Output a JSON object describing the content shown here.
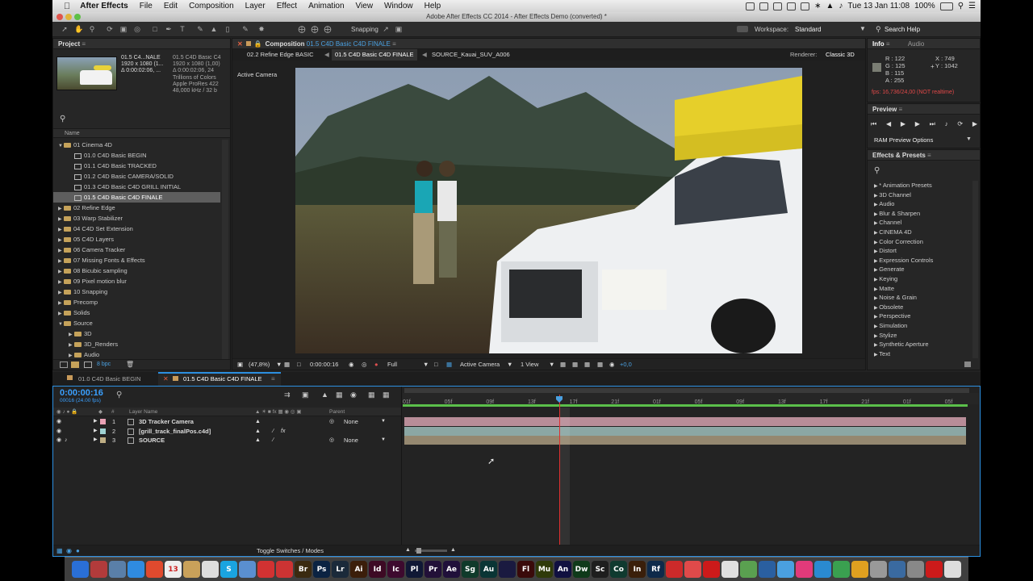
{
  "menubar": {
    "app_name": "After Effects",
    "items": [
      "File",
      "Edit",
      "Composition",
      "Layer",
      "Effect",
      "Animation",
      "View",
      "Window",
      "Help"
    ],
    "clock": "Tue 13 Jan 11:08",
    "battery": "100%"
  },
  "window": {
    "title": "Adobe After Effects CC 2014 - After Effects Demo (converted) *"
  },
  "toolbar": {
    "snapping_label": "Snapping",
    "workspace_label": "Workspace:",
    "workspace_value": "Standard",
    "search_help": "Search Help"
  },
  "project": {
    "tab_label": "Project",
    "thumb_name": "01.5 C4...NALE",
    "info_lines": [
      "01.5 C4D Basic C4",
      "1920 x 1080 (1,00)",
      "Δ 0:00:02:06, 24",
      "Trillions of Colors",
      "Apple ProRes 422",
      "48,000 kHz / 32 b"
    ],
    "info_small": [
      "1920 x 1080 (1...",
      "Δ 0:00:02:06, ..."
    ],
    "col_name": "Name",
    "bpc": "8 bpc",
    "tree": [
      {
        "label": "01 Cinema 4D",
        "level": 0,
        "type": "folder",
        "open": true
      },
      {
        "label": "01.0 C4D Basic BEGIN",
        "level": 1,
        "type": "comp"
      },
      {
        "label": "01.1 C4D Basic TRACKED",
        "level": 1,
        "type": "comp"
      },
      {
        "label": "01.2 C4D Basic CAMERA/SOLID",
        "level": 1,
        "type": "comp"
      },
      {
        "label": "01.3 C4D Basic C4D GRILL INITIAL",
        "level": 1,
        "type": "comp"
      },
      {
        "label": "01.5 C4D Basic C4D FINALE",
        "level": 1,
        "type": "comp",
        "selected": true
      },
      {
        "label": "02 Refine Edge",
        "level": 0,
        "type": "folder"
      },
      {
        "label": "03 Warp Stabilizer",
        "level": 0,
        "type": "folder"
      },
      {
        "label": "04 C4D Set Extension",
        "level": 0,
        "type": "folder"
      },
      {
        "label": "05 C4D Layers",
        "level": 0,
        "type": "folder"
      },
      {
        "label": "06 Camera Tracker",
        "level": 0,
        "type": "folder"
      },
      {
        "label": "07 Missing Fonts & Effects",
        "level": 0,
        "type": "folder"
      },
      {
        "label": "08 Bicubic sampling",
        "level": 0,
        "type": "folder"
      },
      {
        "label": "09 Pixel motion blur",
        "level": 0,
        "type": "folder"
      },
      {
        "label": "10 Snapping",
        "level": 0,
        "type": "folder"
      },
      {
        "label": "Precomp",
        "level": 0,
        "type": "folder"
      },
      {
        "label": "Solids",
        "level": 0,
        "type": "folder"
      },
      {
        "label": "Source",
        "level": 0,
        "type": "folder",
        "open": true
      },
      {
        "label": "3D",
        "level": 1,
        "type": "folder"
      },
      {
        "label": "3D_Renders",
        "level": 1,
        "type": "folder"
      },
      {
        "label": "Audio",
        "level": 1,
        "type": "folder"
      }
    ]
  },
  "composition": {
    "panel_label": "Composition",
    "panel_comp": "01.5 C4D Basic C4D FINALE",
    "crumbs": [
      "02.2 Refine Edge BASIC",
      "01.5 C4D Basic C4D FINALE",
      "SOURCE_Kauai_SUV_A006"
    ],
    "renderer_label": "Renderer:",
    "renderer_value": "Classic 3D",
    "active_camera": "Active Camera",
    "zoom": "(47,8%)",
    "timecode": "0:00:00:16",
    "resolution": "Full",
    "view_camera": "Active Camera",
    "view_count": "1 View",
    "exposure": "+0,0"
  },
  "info": {
    "tab_info": "Info",
    "tab_audio": "Audio",
    "r": "R : 122",
    "g": "G : 125",
    "b": "B : 115",
    "a": "A : 255",
    "x": "X : 749",
    "y": "Y : 1042",
    "fps_warning": "fps: 16,736/24,00 (NOT realtime)"
  },
  "preview": {
    "label": "Preview",
    "ram_label": "RAM Preview Options"
  },
  "effects": {
    "label": "Effects & Presets",
    "items": [
      "* Animation Presets",
      "3D Channel",
      "Audio",
      "Blur & Sharpen",
      "Channel",
      "CINEMA 4D",
      "Color Correction",
      "Distort",
      "Expression Controls",
      "Generate",
      "Keying",
      "Matte",
      "Noise & Grain",
      "Obsolete",
      "Perspective",
      "Simulation",
      "Stylize",
      "Synthetic Aperture",
      "Text"
    ]
  },
  "timeline": {
    "tabs": [
      "01.0 C4D Basic BEGIN",
      "01.5 C4D Basic C4D FINALE"
    ],
    "timecode": "0:00:00:16",
    "frames": "00016 (24.00 fps)",
    "col_layer": "Layer Name",
    "col_parent": "Parent",
    "layers": [
      {
        "num": "1",
        "name": "3D Tracker Camera",
        "color": "#e8a1b4",
        "parent": "None",
        "bar": "#b88d98"
      },
      {
        "num": "2",
        "name": "[grill_track_finalPos.c4d]",
        "color": "#9fd2d2",
        "parent": "",
        "bar": "#8ba7a4"
      },
      {
        "num": "3",
        "name": "SOURCE",
        "color": "#bfae84",
        "parent": "None",
        "bar": "#958870"
      }
    ],
    "ruler": [
      "01f",
      "05f",
      "09f",
      "13f",
      "17f",
      "21f",
      "01f",
      "05f",
      "09f",
      "13f",
      "17f",
      "21f",
      "01f",
      "05f"
    ],
    "toggle": "Toggle Switches / Modes",
    "playhead_fraction": 0.277
  },
  "dock": {
    "apps": [
      {
        "t": "",
        "c": "#2a6fd6"
      },
      {
        "t": "",
        "c": "#b23b3b"
      },
      {
        "t": "",
        "c": "#5a7fa8"
      },
      {
        "t": "",
        "c": "#2f8be0"
      },
      {
        "t": "",
        "c": "#e04a2e"
      },
      {
        "t": "13",
        "c": "#eeeeee"
      },
      {
        "t": "",
        "c": "#c9a15a"
      },
      {
        "t": "",
        "c": "#ddd"
      },
      {
        "t": "S",
        "c": "#1aa4e0"
      },
      {
        "t": "",
        "c": "#5a8fd0"
      },
      {
        "t": "",
        "c": "#d23232"
      },
      {
        "t": "",
        "c": "#cc3333"
      },
      {
        "t": "Br",
        "c": "#3a2a10"
      },
      {
        "t": "Ps",
        "c": "#0b2342"
      },
      {
        "t": "Lr",
        "c": "#1b2a3a"
      },
      {
        "t": "Ai",
        "c": "#3b1e0a"
      },
      {
        "t": "Id",
        "c": "#3d0a24"
      },
      {
        "t": "Ic",
        "c": "#3d0a2e"
      },
      {
        "t": "Pl",
        "c": "#101835"
      },
      {
        "t": "Pr",
        "c": "#221038"
      },
      {
        "t": "Ae",
        "c": "#20103a"
      },
      {
        "t": "Sg",
        "c": "#0f3a2a"
      },
      {
        "t": "Au",
        "c": "#0a3535"
      },
      {
        "t": "",
        "c": "#1a1a40"
      },
      {
        "t": "Fl",
        "c": "#3a0a0a"
      },
      {
        "t": "Mu",
        "c": "#2f3a0a"
      },
      {
        "t": "An",
        "c": "#101040"
      },
      {
        "t": "Dw",
        "c": "#0f3a1a"
      },
      {
        "t": "Sc",
        "c": "#1e1e1e"
      },
      {
        "t": "Co",
        "c": "#0f3a2f"
      },
      {
        "t": "In",
        "c": "#3a1f0a"
      },
      {
        "t": "Rf",
        "c": "#0e2a4a"
      },
      {
        "t": "",
        "c": "#cc2a2a"
      },
      {
        "t": "",
        "c": "#e04a4a"
      },
      {
        "t": "",
        "c": "#cc1a1a"
      },
      {
        "t": "",
        "c": "#e0e0e0"
      },
      {
        "t": "",
        "c": "#5aa050"
      },
      {
        "t": "",
        "c": "#2a5fa0"
      },
      {
        "t": "",
        "c": "#4aa0e0"
      },
      {
        "t": "",
        "c": "#e23a7a"
      },
      {
        "t": "",
        "c": "#2a8ad0"
      },
      {
        "t": "",
        "c": "#3aa050"
      },
      {
        "t": "",
        "c": "#e0a020"
      },
      {
        "t": "",
        "c": "#999"
      },
      {
        "t": "",
        "c": "#3a6aa0"
      },
      {
        "t": "",
        "c": "#888"
      },
      {
        "t": "",
        "c": "#cc1a1a"
      },
      {
        "t": "",
        "c": "#ddd"
      }
    ]
  },
  "colors": {
    "accent": "#2c8fe0",
    "playhead": "#e03030",
    "warning": "#e04848",
    "timecode": "#3aa0ff"
  }
}
